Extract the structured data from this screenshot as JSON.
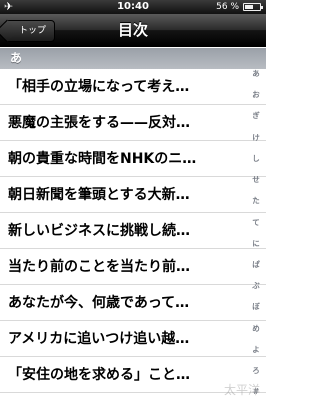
{
  "status_bar": {
    "time": "10:40",
    "battery_percent": "56 %",
    "battery_level": 0.56
  },
  "nav": {
    "back_label": "トップ",
    "title": "目次"
  },
  "section": {
    "header": "あ"
  },
  "items": [
    "「相手の立場になって考え…",
    "悪魔の主張をする——反対…",
    "朝の貴重な時間をNHKのニ…",
    "朝日新聞を筆頭とする大新…",
    "新しいビジネスに挑戦し続…",
    "当たり前のことを当たり前…",
    "あなたが今、何歳であって…",
    "アメリカに追いつけ追い越…",
    "「安住の地を求める」こと…"
  ],
  "index": [
    "あ",
    "お",
    "ぎ",
    "け",
    "し",
    "せ",
    "た",
    "て",
    "に",
    "ぱ",
    "ぶ",
    "ぼ",
    "め",
    "よ",
    "ろ",
    "#"
  ],
  "watermark": "太平洋"
}
